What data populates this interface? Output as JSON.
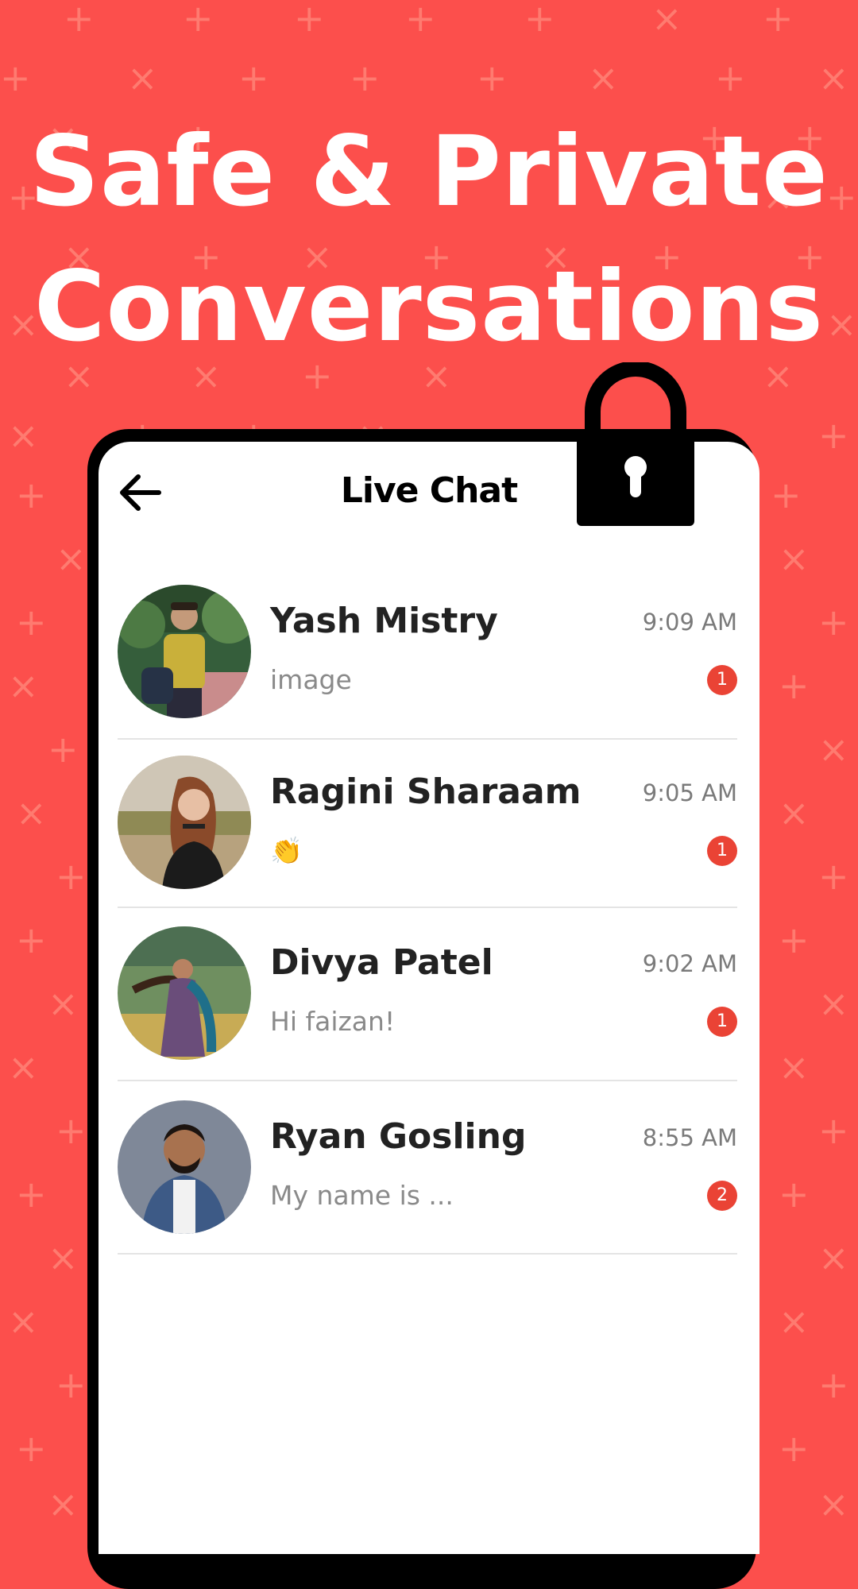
{
  "headline": {
    "line1": "Safe & Private",
    "line2": "Conversations"
  },
  "header": {
    "title": "Live Chat",
    "back_icon": "arrow-left-icon",
    "lock_icon": "padlock-icon"
  },
  "colors": {
    "background": "#fc4f4c",
    "badge": "#ea4335",
    "frame": "#000000"
  },
  "chats": [
    {
      "name": "Yash Mistry",
      "time": "9:09 AM",
      "preview": "image",
      "unread": "1"
    },
    {
      "name": "Ragini Sharaam",
      "time": "9:05 AM",
      "preview": "👏",
      "unread": "1"
    },
    {
      "name": "Divya Patel",
      "time": "9:02 AM",
      "preview": "Hi faizan!",
      "unread": "1"
    },
    {
      "name": "Ryan Gosling",
      "time": "8:55 AM",
      "preview": "My name is ...",
      "unread": "2"
    }
  ]
}
